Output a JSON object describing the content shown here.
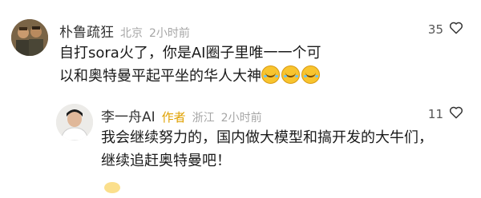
{
  "comments": [
    {
      "author": "朴鲁疏狂",
      "location": "北京",
      "time": "2小时前",
      "likes": "35",
      "text": "自打sora火了，你是AI圈子里唯一一个可以和奥特曼平起平坐的华人大神",
      "emoji_icons": [
        "laughing-tears-emoji",
        "laughing-tears-emoji",
        "laughing-tears-emoji"
      ]
    },
    {
      "author": "李一舟AI",
      "badge": "作者",
      "location": "浙江",
      "time": "2小时前",
      "likes": "11",
      "text": "我会继续努力的，国内做大模型和搞开发的大牛们，继续追赶奥特曼吧！"
    }
  ],
  "colors": {
    "author_badge": "#e0a100",
    "meta_gray": "#a6a6a6"
  }
}
